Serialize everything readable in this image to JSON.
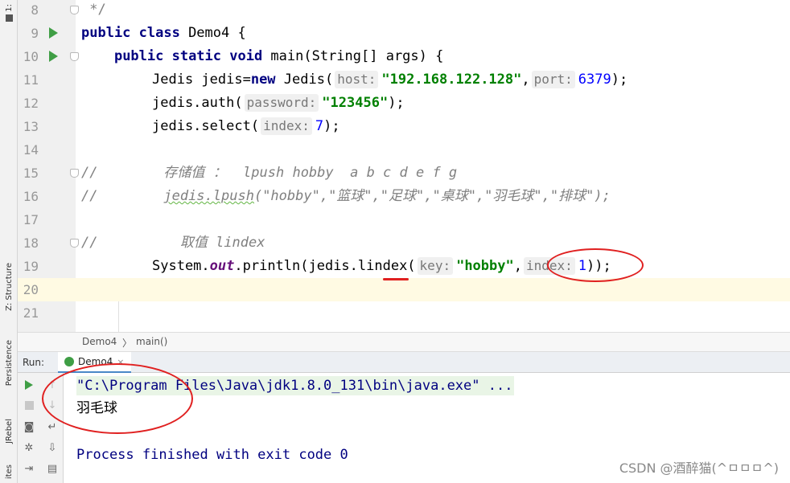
{
  "sidebar": {
    "top_tab": "1:",
    "structure_tab": "Z: Structure",
    "persistence_tab": "Persistence",
    "jrebel_tab": "JRebel",
    "bottom_tab": "ites"
  },
  "editor": {
    "lines": [
      {
        "number": "8"
      },
      {
        "number": "9"
      },
      {
        "number": "10"
      },
      {
        "number": "11"
      },
      {
        "number": "12"
      },
      {
        "number": "13"
      },
      {
        "number": "14"
      },
      {
        "number": "15"
      },
      {
        "number": "16"
      },
      {
        "number": "17"
      },
      {
        "number": "18"
      },
      {
        "number": "19"
      },
      {
        "number": "20"
      },
      {
        "number": "21"
      }
    ],
    "code": {
      "l8": " */",
      "l9_kw": "public class ",
      "l9_rest": "Demo4 {",
      "l10_indent": "    ",
      "l10_kw": "public static void ",
      "l10_rest": "main(String[] args) {",
      "l11_a": "Jedis jedis=",
      "l11_kw": "new ",
      "l11_b": "Jedis(",
      "l11_hint1": "host:",
      "l11_str": "\"192.168.122.128\"",
      "l11_c": ",",
      "l11_hint2": "port:",
      "l11_num": "6379",
      "l11_d": ");",
      "l12_a": "jedis.auth(",
      "l12_hint": "password:",
      "l12_str": "\"123456\"",
      "l12_b": ");",
      "l13_a": "jedis.select(",
      "l13_hint": "index:",
      "l13_num": "7",
      "l13_b": ");",
      "l15": "//        存储值 ：  lpush hobby  a b c d e f g",
      "l16_a": "//        ",
      "l16_sq": "jedis.lpush",
      "l16_b": "(\"hobby\",\"篮球\",\"足球\",\"桌球\",\"羽毛球\",\"排球\");",
      "l18": "//          取值 lindex",
      "l19_a": "System.",
      "l19_out": "out",
      "l19_b": ".println(jedis.lindex(",
      "l19_hint1": "key:",
      "l19_str": "\"hobby\"",
      "l19_c": ",",
      "l19_hint2": "index:",
      "l19_num": "1",
      "l19_d": "));"
    }
  },
  "breadcrumb": {
    "class": "Demo4",
    "separator": "〉",
    "method": "main()"
  },
  "run_panel": {
    "label": "Run:",
    "tab_label": "Demo4",
    "tab_close": "×",
    "console": {
      "command": "\"C:\\Program Files\\Java\\jdk1.8.0_131\\bin\\java.exe\" ...",
      "output": "羽毛球",
      "exit": "Process finished with exit code 0"
    },
    "toolbar_icons": [
      "rerun-icon",
      "up-arrow-icon",
      "stop-icon",
      "down-arrow-icon",
      "camera-icon",
      "soft-wrap-icon",
      "debug-icon",
      "scroll-to-end-icon",
      "exit-icon",
      "print-icon"
    ]
  },
  "watermark": "CSDN @酒醉猫(^ㅁㅁㅁ^)",
  "colors": {
    "keyword": "#000080",
    "string": "#008000",
    "number": "#0000ff",
    "comment": "#808080",
    "current_line": "#fffae3",
    "annotation_red": "#e02020"
  }
}
